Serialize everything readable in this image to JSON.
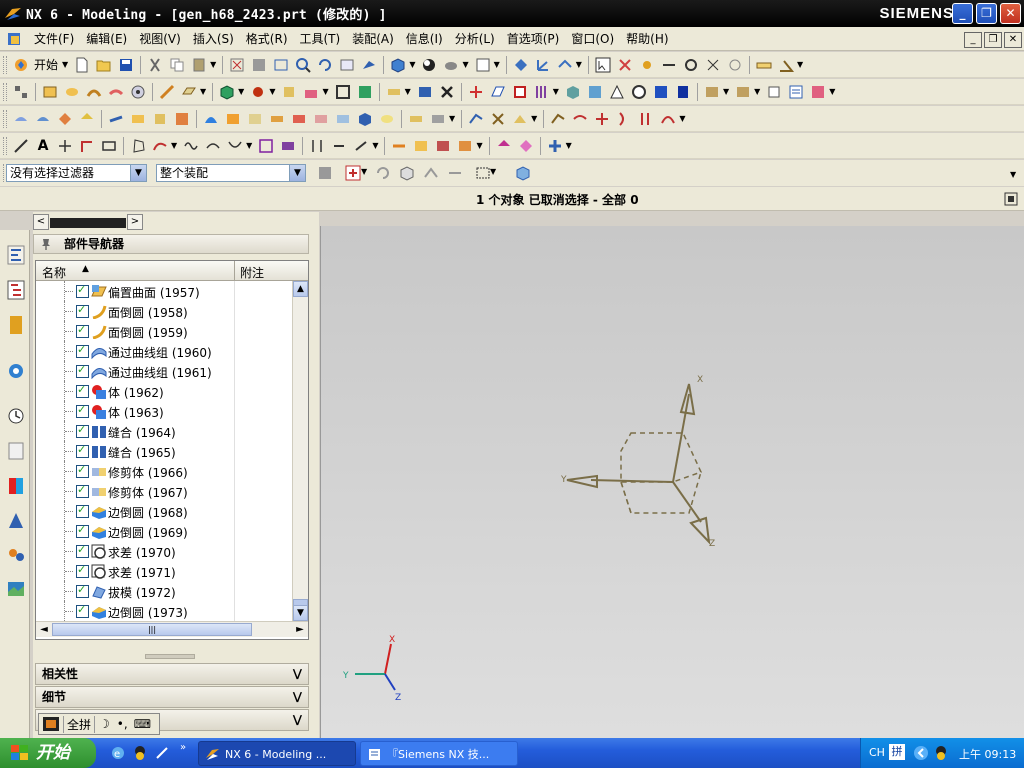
{
  "window": {
    "title": "NX 6 - Modeling - [gen_h68_2423.prt  (修改的) ]",
    "brand": "SIEMENS",
    "controls": {
      "minimize": "_",
      "restore": "❐",
      "close": "✕"
    }
  },
  "menubar": {
    "items": [
      "文件(F)",
      "编辑(E)",
      "视图(V)",
      "插入(S)",
      "格式(R)",
      "工具(T)",
      "装配(A)",
      "信息(I)",
      "分析(L)",
      "首选项(P)",
      "窗口(O)",
      "帮助(H)"
    ]
  },
  "toolbar": {
    "start_label": "开始"
  },
  "filterbar": {
    "selection_filter": "没有选择过滤器",
    "assembly_scope": "整个装配"
  },
  "status": {
    "text": "1 个对象 已取消选择  - 全部 0"
  },
  "navigator": {
    "title": "部件导航器",
    "columns": {
      "name": "名称",
      "note": "附注"
    },
    "items": [
      {
        "label": "偏置曲面 (1957)",
        "icon": "offset-surface-icon"
      },
      {
        "label": "面倒圆 (1958)",
        "icon": "face-blend-icon"
      },
      {
        "label": "面倒圆 (1959)",
        "icon": "face-blend-icon"
      },
      {
        "label": "通过曲线组 (1960)",
        "icon": "through-curves-icon"
      },
      {
        "label": "通过曲线组 (1961)",
        "icon": "through-curves-icon"
      },
      {
        "label": "体 (1962)",
        "icon": "body-icon"
      },
      {
        "label": "体 (1963)",
        "icon": "body-icon"
      },
      {
        "label": "缝合 (1964)",
        "icon": "sew-icon"
      },
      {
        "label": "缝合 (1965)",
        "icon": "sew-icon"
      },
      {
        "label": "修剪体 (1966)",
        "icon": "trim-body-icon"
      },
      {
        "label": "修剪体 (1967)",
        "icon": "trim-body-icon"
      },
      {
        "label": "边倒圆 (1968)",
        "icon": "edge-blend-icon"
      },
      {
        "label": "边倒圆 (1969)",
        "icon": "edge-blend-icon"
      },
      {
        "label": "求差 (1970)",
        "icon": "subtract-icon"
      },
      {
        "label": "求差 (1971)",
        "icon": "subtract-icon"
      },
      {
        "label": "拔模 (1972)",
        "icon": "draft-icon"
      },
      {
        "label": "边倒圆 (1973)",
        "icon": "edge-blend-icon"
      }
    ],
    "sections": [
      "相关性",
      "细节"
    ]
  },
  "graphics": {
    "triad_labels": {
      "x": "X",
      "y": "Y",
      "z": "Z"
    },
    "csys_labels": {
      "x": "X",
      "y": "Y",
      "z": "Z"
    },
    "colors": {
      "csys": "#7a6e48",
      "view_x": "#d02020",
      "view_y": "#20a080",
      "view_z": "#2040c0"
    }
  },
  "ime": {
    "mode": "全拼"
  },
  "taskbar": {
    "start": "开始",
    "tasks": [
      "NX 6 - Modeling ...",
      "『Siemens NX 技..."
    ],
    "tray": {
      "lang": "CH",
      "ime": "拼",
      "time": "上午 09:13"
    }
  }
}
